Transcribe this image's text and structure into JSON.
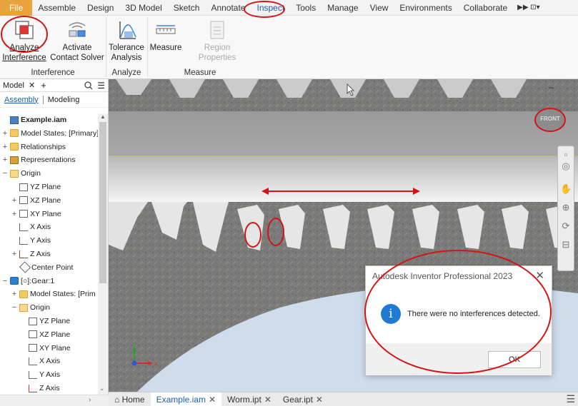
{
  "menu": {
    "file": "File",
    "items": [
      "Assemble",
      "Design",
      "3D Model",
      "Sketch",
      "Annotate",
      "Inspect",
      "Tools",
      "Manage",
      "View",
      "Environments",
      "Collaborate"
    ],
    "active": "Inspect"
  },
  "ribbon": {
    "analyze_interference": "Analyze\nInterference",
    "activate_contact_solver": "Activate\nContact Solver",
    "tolerance_analysis": "Tolerance\nAnalysis",
    "measure": "Measure",
    "region_properties": "Region Properties",
    "panels": {
      "interference": "Interference",
      "analyze": "Analyze",
      "measure": "Measure"
    }
  },
  "browser": {
    "title": "Model",
    "tabs": {
      "assembly": "Assembly",
      "modeling": "Modeling"
    },
    "tree": [
      {
        "label": "Example.iam",
        "expander": "",
        "icon": "assembly",
        "indent": 0
      },
      {
        "label": "Model States: [Primary]",
        "expander": "+",
        "icon": "folder",
        "indent": 0
      },
      {
        "label": "Relationships",
        "expander": "+",
        "icon": "folder",
        "indent": 0
      },
      {
        "label": "Representations",
        "expander": "+",
        "icon": "rep",
        "indent": 0
      },
      {
        "label": "Origin",
        "expander": "−",
        "icon": "folder-open",
        "indent": 0
      },
      {
        "label": "YZ Plane",
        "expander": "",
        "icon": "plane",
        "indent": 1
      },
      {
        "label": "XZ Plane",
        "expander": "+",
        "icon": "plane",
        "indent": 1
      },
      {
        "label": "XY Plane",
        "expander": "+",
        "icon": "plane",
        "indent": 1
      },
      {
        "label": "X Axis",
        "expander": "",
        "icon": "axis",
        "indent": 1
      },
      {
        "label": "Y Axis",
        "expander": "",
        "icon": "axis",
        "indent": 1
      },
      {
        "label": "Z Axis",
        "expander": "+",
        "icon": "axis-red",
        "indent": 1
      },
      {
        "label": "Center Point",
        "expander": "",
        "icon": "point",
        "indent": 1
      },
      {
        "label": "[○]:Gear:1",
        "expander": "−",
        "icon": "part",
        "indent": 0
      },
      {
        "label": "Model States: [Prim",
        "expander": "+",
        "icon": "folder",
        "indent": 1
      },
      {
        "label": "Origin",
        "expander": "−",
        "icon": "folder-open",
        "indent": 1
      },
      {
        "label": "YZ Plane",
        "expander": "",
        "icon": "plane",
        "indent": 2
      },
      {
        "label": "XZ Plane",
        "expander": "",
        "icon": "plane",
        "indent": 2
      },
      {
        "label": "XY Plane",
        "expander": "",
        "icon": "plane",
        "indent": 2
      },
      {
        "label": "X Axis",
        "expander": "",
        "icon": "axis",
        "indent": 2
      },
      {
        "label": "Y Axis",
        "expander": "",
        "icon": "axis",
        "indent": 2
      },
      {
        "label": "Z Axis",
        "expander": "",
        "icon": "axis-red",
        "indent": 2
      }
    ]
  },
  "viewport": {
    "viewcube_label": "FRONT"
  },
  "dialog": {
    "title": "Autodesk Inventor Professional 2023",
    "message": "There were no interferences detected.",
    "ok": "OK"
  },
  "doc_tabs": {
    "home": "Home",
    "tabs": [
      {
        "label": "Example.iam",
        "active": true
      },
      {
        "label": "Worm.ipt",
        "active": false
      },
      {
        "label": "Gear.ipt",
        "active": false
      }
    ]
  },
  "colors": {
    "file_menu": "#e8a33b",
    "accent": "#1a5fb4",
    "annotation": "#d41414",
    "info_icon": "#1e7ad3"
  }
}
